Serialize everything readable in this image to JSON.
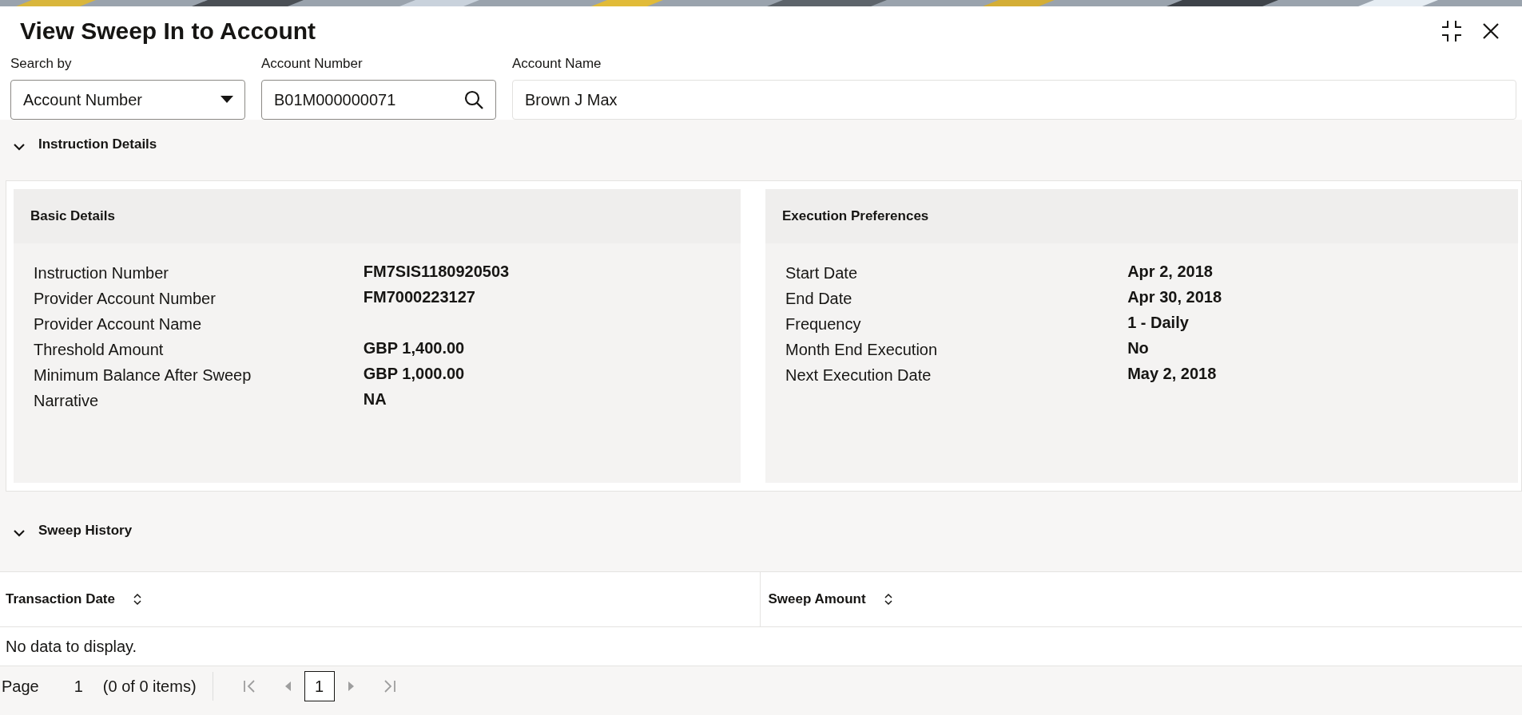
{
  "window": {
    "title": "View Sweep In to Account"
  },
  "search": {
    "search_by": {
      "label": "Search by",
      "value": "Account Number"
    },
    "account_number": {
      "label": "Account Number",
      "value": "B01M000000071"
    },
    "account_name": {
      "label": "Account Name",
      "value": "Brown J Max"
    }
  },
  "instruction_details": {
    "title": "Instruction Details",
    "expanded": true,
    "cards": [
      {
        "title": "Basic Details",
        "rows": [
          {
            "label": "Instruction Number",
            "value": "FM7SIS1180920503"
          },
          {
            "label": "Provider Account Number",
            "value": "FM7000223127"
          },
          {
            "label": "Provider Account Name"
          },
          {
            "label": "Threshold Amount",
            "value": "GBP 1,400.00"
          },
          {
            "label": "Minimum Balance After Sweep",
            "value": "GBP 1,000.00"
          },
          {
            "label": "Narrative",
            "value": "NA"
          }
        ]
      },
      {
        "title": "Execution Preferences",
        "rows": [
          {
            "label": "Start Date",
            "value": "Apr 2, 2018"
          },
          {
            "label": "End Date",
            "value": "Apr 30, 2018"
          },
          {
            "label": "Frequency",
            "value": "1 - Daily"
          },
          {
            "label": "Month End Execution",
            "value": "No"
          },
          {
            "label": "Next Execution Date",
            "value": "May 2, 2018"
          }
        ]
      }
    ]
  },
  "sweep_history": {
    "title": "Sweep History",
    "expanded": true,
    "table": {
      "columns": [
        "Transaction Date",
        "Sweep Amount"
      ],
      "empty_message": "No data to display."
    },
    "pagination": {
      "label": "Page",
      "page": "1",
      "summary": "(0 of 0 items)",
      "pages": [
        {
          "label": "1",
          "selected": true
        }
      ]
    }
  }
}
